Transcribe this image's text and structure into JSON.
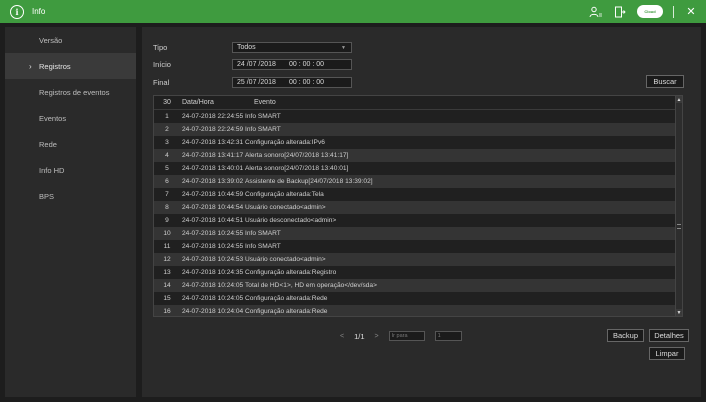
{
  "window": {
    "title": "Info",
    "icons": [
      "user-switch-icon",
      "logout-icon",
      "cloud-status-icon",
      "close-icon"
    ],
    "cloud_label": "Cloud",
    "accent_color": "#3f9b3f"
  },
  "sidebar": {
    "items": [
      {
        "label": "Versão",
        "active": false
      },
      {
        "label": "Registros",
        "active": true
      },
      {
        "label": "Registros de eventos",
        "active": false
      },
      {
        "label": "Eventos",
        "active": false
      },
      {
        "label": "Rede",
        "active": false
      },
      {
        "label": "Info HD",
        "active": false
      },
      {
        "label": "BPS",
        "active": false
      }
    ]
  },
  "filters": {
    "tipo_label": "Tipo",
    "tipo_value": "Todos",
    "inicio_label": "Início",
    "inicio_date": "24 /07 /2018",
    "inicio_time": "00 : 00 : 00",
    "final_label": "Final",
    "final_date": "25 /07 /2018",
    "final_time": "00 : 00 : 00",
    "search_button": "Buscar"
  },
  "table": {
    "count": "30",
    "col_date": "Data/Hora",
    "col_event": "Evento",
    "rows": [
      {
        "n": "1",
        "date": "24-07-2018 22:24:55",
        "event": "Info SMART"
      },
      {
        "n": "2",
        "date": "24-07-2018 22:24:59",
        "event": "Info SMART"
      },
      {
        "n": "3",
        "date": "24-07-2018 13:42:31",
        "event": "Configuração alterada:IPv6"
      },
      {
        "n": "4",
        "date": "24-07-2018 13:41:17",
        "event": "Alerta sonoro[24/07/2018 13:41:17]"
      },
      {
        "n": "5",
        "date": "24-07-2018 13:40:01",
        "event": "Alerta sonoro[24/07/2018 13:40:01]"
      },
      {
        "n": "6",
        "date": "24-07-2018 13:39:02",
        "event": "Assistente de Backup[24/07/2018 13:39:02]"
      },
      {
        "n": "7",
        "date": "24-07-2018 10:44:59",
        "event": "Configuração alterada:Tela"
      },
      {
        "n": "8",
        "date": "24-07-2018 10:44:54",
        "event": "Usuário conectado<admin>"
      },
      {
        "n": "9",
        "date": "24-07-2018 10:44:51",
        "event": "Usuário desconectado<admin>"
      },
      {
        "n": "10",
        "date": "24-07-2018 10:24:55",
        "event": "Info SMART"
      },
      {
        "n": "11",
        "date": "24-07-2018 10:24:55",
        "event": "Info SMART"
      },
      {
        "n": "12",
        "date": "24-07-2018 10:24:53",
        "event": "Usuário conectado<admin>"
      },
      {
        "n": "13",
        "date": "24-07-2018 10:24:35",
        "event": "Configuração alterada:Registro"
      },
      {
        "n": "14",
        "date": "24-07-2018 10:24:05",
        "event": "Total de HD<1>, HD em operação</dev/sda>"
      },
      {
        "n": "15",
        "date": "24-07-2018 10:24:05",
        "event": "Configuração alterada:Rede"
      },
      {
        "n": "16",
        "date": "24-07-2018 10:24:04",
        "event": "Configuração alterada:Rede"
      }
    ]
  },
  "pagination": {
    "prev": "<",
    "page": "1/1",
    "next": ">",
    "goto_placeholder": "Ir para",
    "page_input": "1"
  },
  "actions": {
    "backup": "Backup",
    "details": "Detalhes",
    "clear": "Limpar"
  }
}
